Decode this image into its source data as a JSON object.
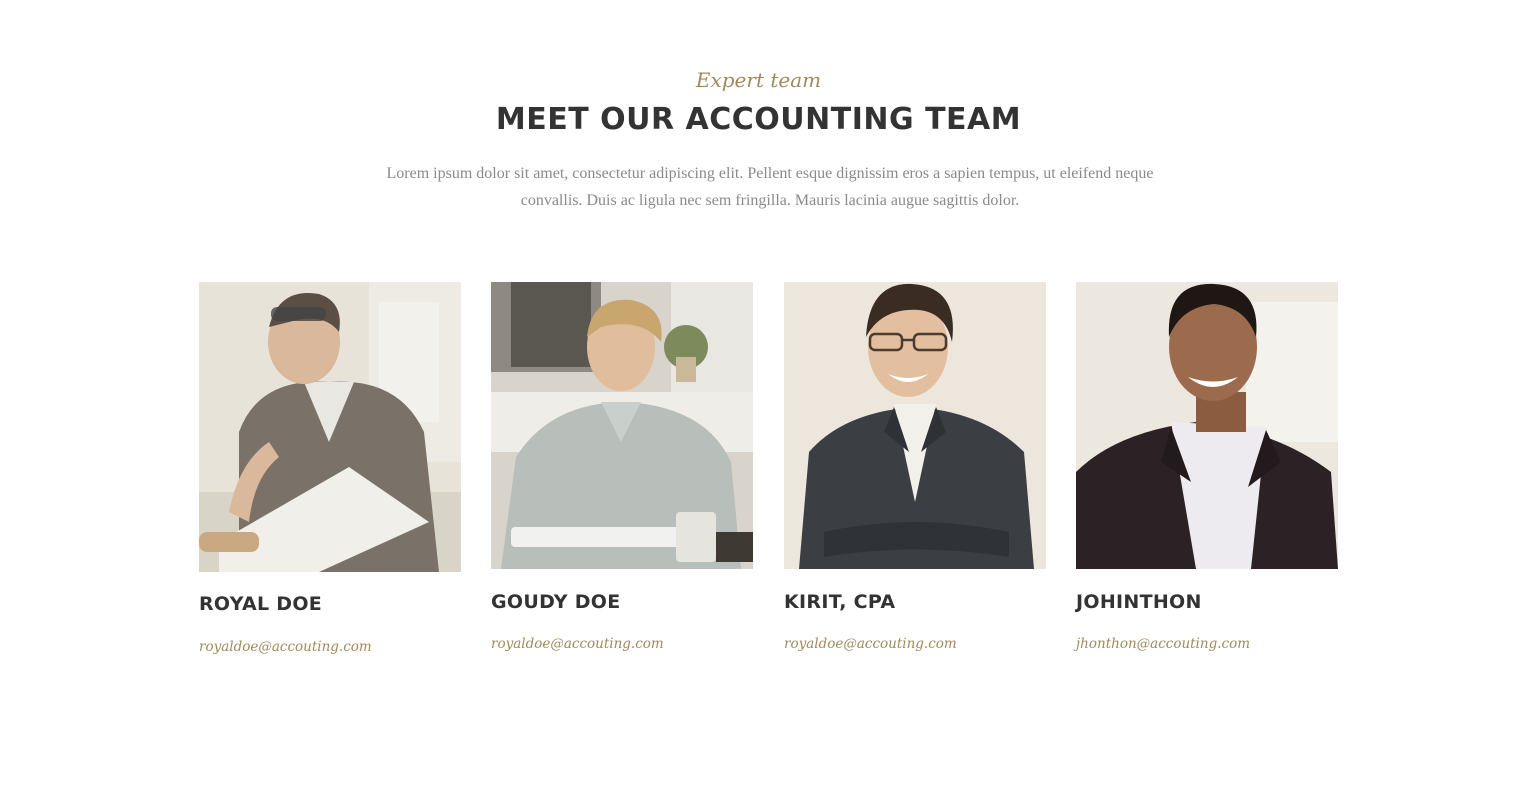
{
  "section": {
    "eyebrow": "Expert team",
    "title": "MEET OUR ACCOUNTING TEAM",
    "intro": "Lorem ipsum dolor sit amet, consectetur adipiscing elit. Pellent esque dignissim eros a sapien tempus, ut eleifend neque convallis. Duis ac ligula nec sem fringilla. Mauris lacinia augue sagittis dolor."
  },
  "team": [
    {
      "name": "ROYAL DOE",
      "email": "royaldoe@accouting.com",
      "photo": "man-reviewing-documents-photo"
    },
    {
      "name": "GOUDY DOE",
      "email": "royaldoe@accouting.com",
      "photo": "man-at-office-desk-photo"
    },
    {
      "name": "KIRIT, CPA",
      "email": "royaldoe@accouting.com",
      "photo": "smiling-man-with-glasses-photo"
    },
    {
      "name": "JOHINTHON",
      "email": "jhonthon@accouting.com",
      "photo": "smiling-man-in-suit-photo"
    }
  ],
  "colors": {
    "accent": "#a08a5c",
    "heading": "#333333",
    "body_text": "#8a8a8a",
    "background": "#ffffff"
  }
}
